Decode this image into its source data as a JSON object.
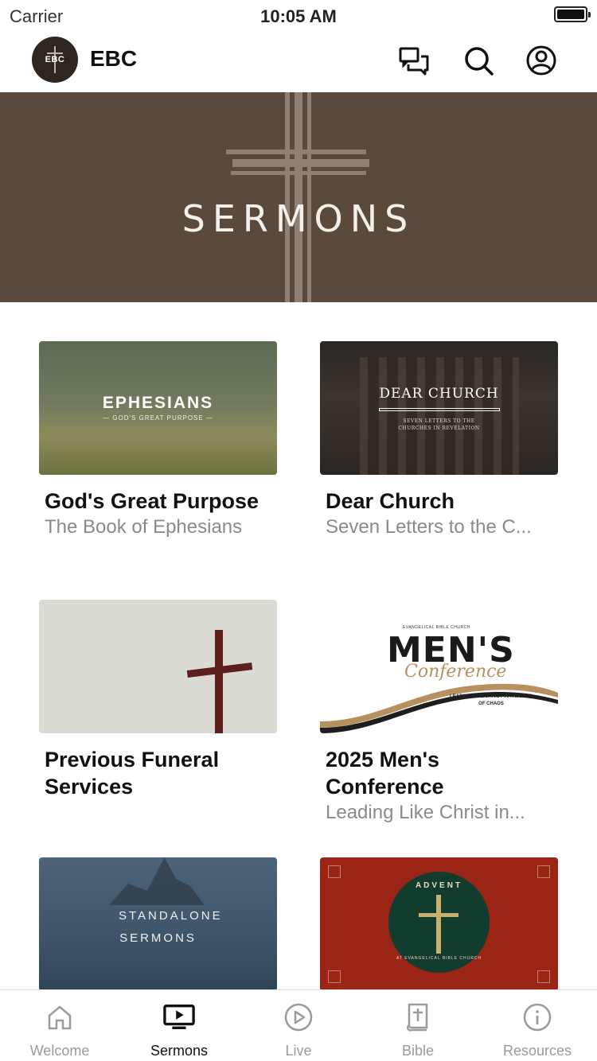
{
  "status_bar": {
    "carrier": "Carrier",
    "time": "10:05 AM"
  },
  "header": {
    "logo_text": "EBC",
    "title": "EBC",
    "icons": [
      "chat-icon",
      "search-icon",
      "account-icon"
    ]
  },
  "hero": {
    "title": "SERMONS"
  },
  "series": [
    {
      "thumb_title": "EPHESIANS",
      "thumb_sub": "— GOD'S GREAT PURPOSE —",
      "title": "God's Great Purpose",
      "subtitle": "The Book of Ephesians"
    },
    {
      "thumb_title": "DEAR CHURCH",
      "thumb_sub": "SEVEN LETTERS TO THE CHURCHES IN REVELATION",
      "title": "Dear Church",
      "subtitle": "Seven Letters to the C..."
    },
    {
      "title": "Previous Funeral Services",
      "subtitle": ""
    },
    {
      "thumb_small": "EVANGELICAL BIBLE CHURCH",
      "thumb_title": "MEN'S",
      "thumb_script": "Conference",
      "thumb_tag": "LEADING LIKE CHRIST IN A WORLD OF CHAOS",
      "title": "2025 Men's Conference",
      "subtitle": "Leading Like Christ in..."
    },
    {
      "thumb_title": "STANDALONE SERMONS"
    },
    {
      "thumb_title": "ADVENT",
      "thumb_ring": "AT EVANGELICAL BIBLE CHURCH"
    }
  ],
  "tabs": [
    {
      "label": "Welcome",
      "icon": "home-icon",
      "active": false
    },
    {
      "label": "Sermons",
      "icon": "tv-play-icon",
      "active": true
    },
    {
      "label": "Live",
      "icon": "play-circle-icon",
      "active": false
    },
    {
      "label": "Bible",
      "icon": "bible-icon",
      "active": false
    },
    {
      "label": "Resources",
      "icon": "info-icon",
      "active": false
    }
  ],
  "colors": {
    "hero_bg": "#5b4a3b",
    "active_tab": "#111111",
    "inactive_tab": "#9a9a9a"
  }
}
